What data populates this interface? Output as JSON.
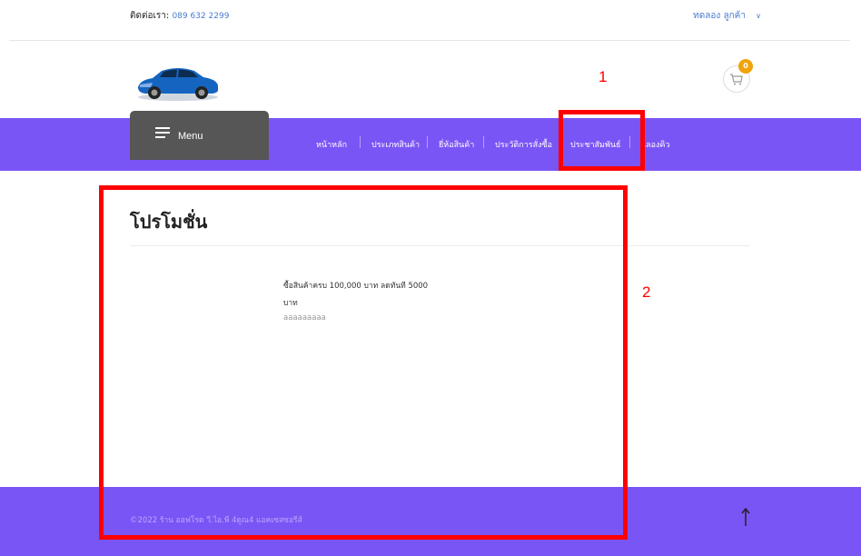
{
  "header": {
    "contact_label": "ติดต่อเรา:",
    "contact_phone": "089 632 2299",
    "account_label": "ทดลอง ลูกค้า",
    "account_chevron": "⌄",
    "cart_count": "0",
    "logo_icon": "car-logo",
    "cart_icon": "cart-icon"
  },
  "nav": {
    "menu_label": "Menu",
    "items": [
      {
        "label": "หน้าหลัก"
      },
      {
        "label": "ประเภทสินค้า"
      },
      {
        "label": "ยี่ห้อสินค้า"
      },
      {
        "label": "ประวัติการสั่งซื้อ"
      },
      {
        "label": "ประชาสัมพันธ์"
      },
      {
        "label": "เลองคิว"
      }
    ]
  },
  "annotations": {
    "box1_number": "1",
    "box2_number": "2",
    "color": "#ff0000"
  },
  "main": {
    "title": "โปรโมชั่น",
    "promo": {
      "line1": "ซื้อสินค้าครบ 100,000 บาท ลดทันที 5000",
      "line2": "บาท",
      "description": "aaaaaaaaa"
    }
  },
  "footer": {
    "copyright": "©2022 ร้าน ออฟโรด วี.ไอ.พี 4ดูณ4 แอคเซสซอรีส์",
    "to_top_icon": "arrow-up-icon"
  },
  "colors": {
    "nav_bg": "#7a55f5",
    "menu_bg": "#565656",
    "link": "#4a7bd0",
    "badge": "#f0a30a"
  }
}
